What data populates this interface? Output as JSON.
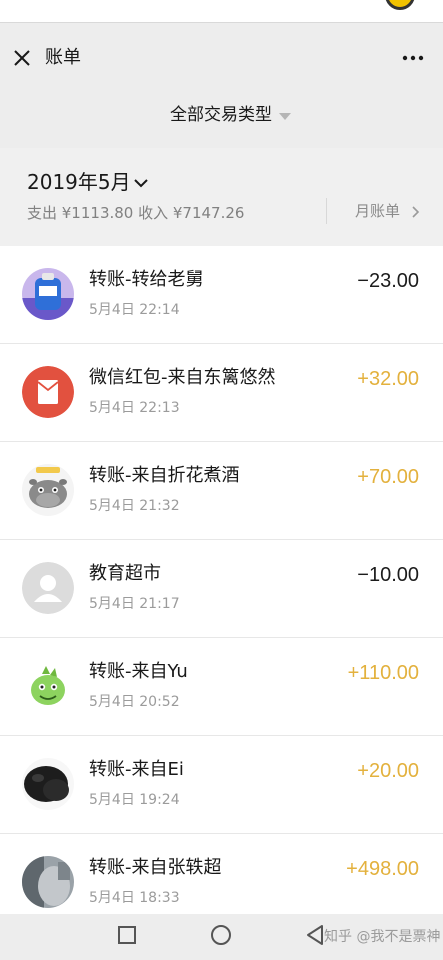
{
  "header": {
    "title": "账单"
  },
  "filter": {
    "label": "全部交易类型"
  },
  "month": {
    "title": "2019年5月",
    "summary": "支出 ¥1113.80 收入 ¥7147.26",
    "bill_link": "月账单"
  },
  "transactions": [
    {
      "title": "转账-转给老舅",
      "time": "5月4日 22:14",
      "amount": "−23.00",
      "kind": "expense",
      "avatar": "purple-photo-avatar"
    },
    {
      "title": "微信红包-来自东篱悠然",
      "time": "5月4日 22:13",
      "amount": "+32.00",
      "kind": "income",
      "avatar": "red-envelope-icon"
    },
    {
      "title": "转账-来自折花煮酒",
      "time": "5月4日 21:32",
      "amount": "+70.00",
      "kind": "income",
      "avatar": "hippo-cartoon-avatar"
    },
    {
      "title": "教育超市",
      "time": "5月4日 21:17",
      "amount": "−10.00",
      "kind": "expense",
      "avatar": "default-user-avatar"
    },
    {
      "title": "转账-来自Yu",
      "time": "5月4日 20:52",
      "amount": "+110.00",
      "kind": "income",
      "avatar": "green-dinosaur-avatar"
    },
    {
      "title": "转账-来自Ei",
      "time": "5月4日 19:24",
      "amount": "+20.00",
      "kind": "income",
      "avatar": "dark-photo-avatar"
    },
    {
      "title": "转账-来自张轶超",
      "time": "5月4日 18:33",
      "amount": "+498.00",
      "kind": "income",
      "avatar": "gray-photo-avatar"
    }
  ],
  "watermark": "知乎 @我不是票神",
  "colors": {
    "income": "#e3b13d",
    "expense": "#1c1c1c",
    "background": "#ededed"
  }
}
